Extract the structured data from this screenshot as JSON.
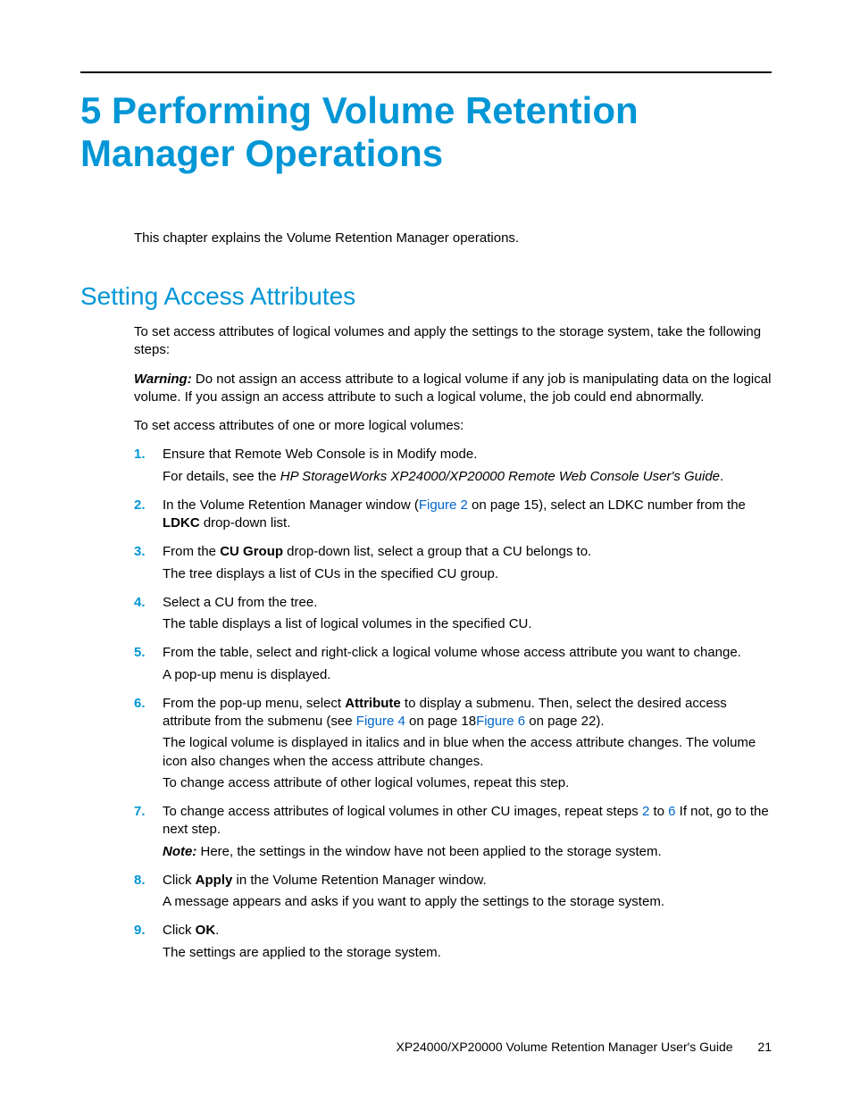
{
  "chapter": {
    "title": "5 Performing Volume Retention Manager Operations",
    "intro": "This chapter explains the Volume Retention Manager operations."
  },
  "section": {
    "title": "Setting Access Attributes",
    "lead": "To set access attributes of logical volumes and apply the settings to the storage system, take the following steps:",
    "warning_label": "Warning:",
    "warning_text": "  Do not assign an access attribute to a logical volume if any job is manipulating data on the logical volume. If you assign an access attribute to such a logical volume, the job could end abnormally.",
    "lead2": "To set access attributes of one or more logical volumes:",
    "steps": {
      "s1a": "Ensure that Remote Web Console is in Modify mode.",
      "s1b_pre": "For details, see the ",
      "s1b_ital": "HP StorageWorks XP24000/XP20000 Remote Web Console User's Guide",
      "s1b_post": ".",
      "s2_pre": "In the Volume Retention Manager window (",
      "s2_link": "Figure 2",
      "s2_mid": " on page 15), select an LDKC number from the ",
      "s2_bold": "LDKC",
      "s2_post": " drop-down list.",
      "s3_pre": "From the ",
      "s3_bold": "CU Group",
      "s3_post": " drop-down list, select a group that a CU belongs to.",
      "s3_sub": "The tree displays a list of CUs in the specified CU group.",
      "s4a": "Select a CU from the tree.",
      "s4b": "The table displays a list of logical volumes in the specified CU.",
      "s5a": "From the table, select and right-click a logical volume whose access attribute you want to change.",
      "s5b": "A pop-up menu is displayed.",
      "s6_pre": "From the pop-up menu, select ",
      "s6_bold": "Attribute",
      "s6_mid": " to display a submenu. Then, select the desired access attribute from the submenu (see ",
      "s6_link1": "Figure 4",
      "s6_mid2": " on page 18",
      "s6_link2": "Figure 6",
      "s6_post": " on page 22).",
      "s6_sub1": "The logical volume is displayed in italics and in blue when the access attribute changes. The volume icon also changes when the access attribute changes.",
      "s6_sub2": "To change access attribute of other logical volumes, repeat this step.",
      "s7_pre": "To change access attributes of logical volumes in other CU images, repeat steps ",
      "s7_link1": "2",
      "s7_mid": " to ",
      "s7_link2": "6",
      "s7_post": " If not, go to the next step.",
      "s7_note_label": "Note:",
      "s7_note_text": "  Here, the settings in the window have not been applied to the storage system.",
      "s8_pre": "Click ",
      "s8_bold": "Apply",
      "s8_post": " in the Volume Retention Manager window.",
      "s8_sub": "A message appears and asks if you want to apply the settings to the storage system.",
      "s9_pre": "Click ",
      "s9_bold": "OK",
      "s9_post": ".",
      "s9_sub": "The settings are applied to the storage system."
    }
  },
  "footer": {
    "text": "XP24000/XP20000 Volume Retention Manager User's Guide",
    "page": "21"
  }
}
